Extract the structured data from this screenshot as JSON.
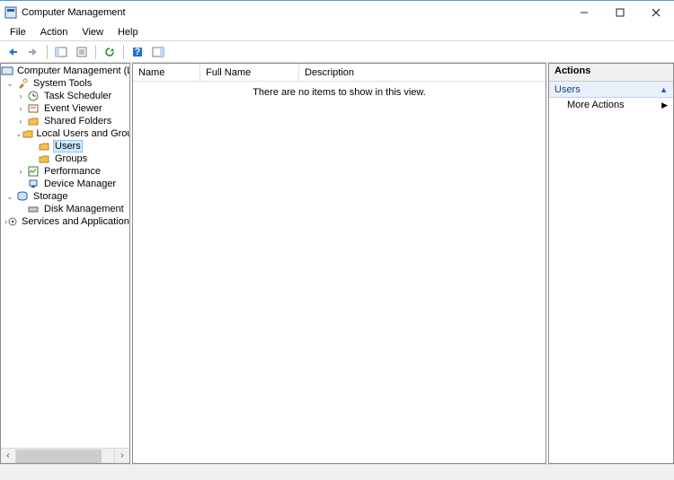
{
  "window": {
    "title": "Computer Management"
  },
  "menu": {
    "file": "File",
    "action": "Action",
    "view": "View",
    "help": "Help"
  },
  "tree": {
    "root": "Computer Management (Local",
    "system_tools": "System Tools",
    "task_scheduler": "Task Scheduler",
    "event_viewer": "Event Viewer",
    "shared_folders": "Shared Folders",
    "local_users_groups": "Local Users and Groups",
    "users": "Users",
    "groups": "Groups",
    "performance": "Performance",
    "device_manager": "Device Manager",
    "storage": "Storage",
    "disk_management": "Disk Management",
    "services_apps": "Services and Applications"
  },
  "list": {
    "col_name": "Name",
    "col_fullname": "Full Name",
    "col_description": "Description",
    "empty_msg": "There are no items to show in this view."
  },
  "actions": {
    "header": "Actions",
    "section": "Users",
    "more": "More Actions"
  }
}
